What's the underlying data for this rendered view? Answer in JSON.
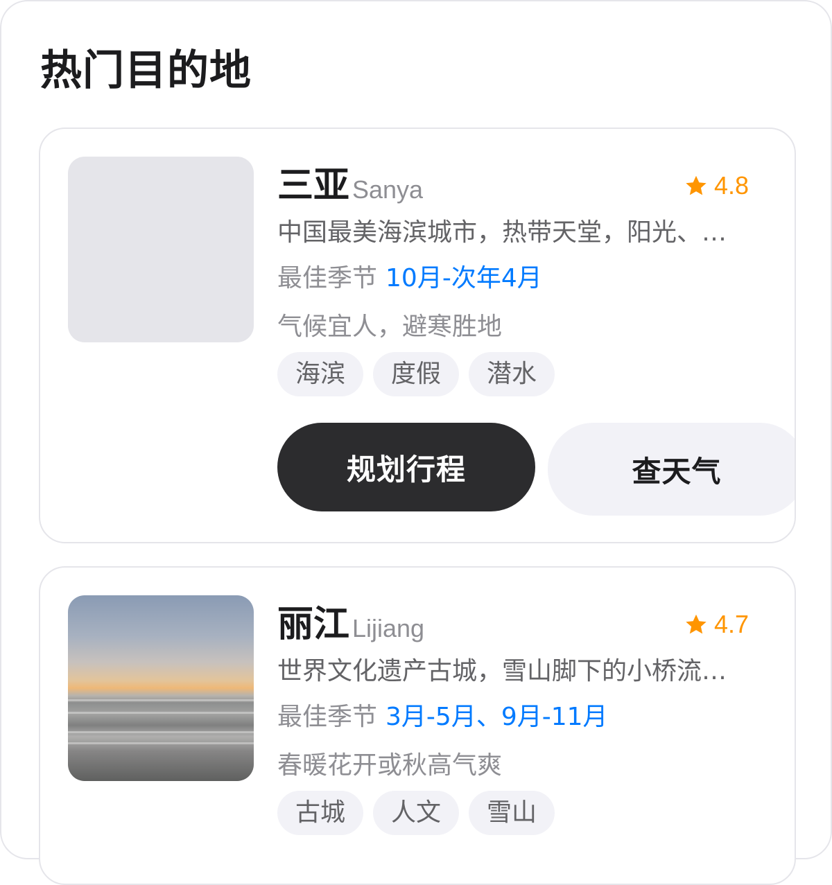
{
  "section": {
    "title": "热门目的地"
  },
  "destinations": [
    {
      "name": "三亚",
      "name_en": "Sanya",
      "rating": "4.8",
      "description": "中国最美海滨城市，热带天堂，阳光、沙滩、椰林",
      "season_label": "最佳季节",
      "season_value": "10月-次年4月",
      "note": "气候宜人，避寒胜地",
      "tags": [
        "海滨",
        "度假",
        "潜水"
      ],
      "primary_action": "规划行程",
      "secondary_action": "查天气"
    },
    {
      "name": "丽江",
      "name_en": "Lijiang",
      "rating": "4.7",
      "description": "世界文化遗产古城，雪山脚下的小桥流水人家",
      "season_label": "最佳季节",
      "season_value": "3月-5月、9月-11月",
      "note": "春暖花开或秋高气爽",
      "tags": [
        "古城",
        "人文",
        "雪山"
      ]
    }
  ],
  "colors": {
    "accent_blue": "#007aff",
    "rating_orange": "#ff9500",
    "primary_button": "#2c2c2e",
    "tag_background": "#f2f2f7"
  },
  "icons": {
    "rating": "star-icon"
  }
}
